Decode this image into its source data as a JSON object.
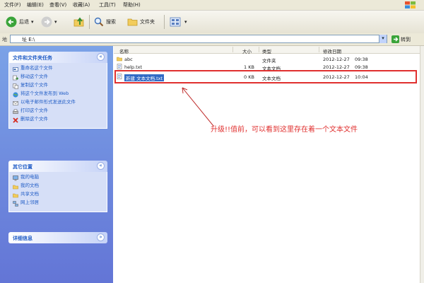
{
  "menubar": {
    "items": [
      "文件(F)",
      "编辑(E)",
      "查看(V)",
      "收藏(A)",
      "工具(T)",
      "帮助(H)"
    ]
  },
  "toolbar": {
    "back_label": "后退",
    "search_label": "搜索",
    "folders_label": "文件夹"
  },
  "address": {
    "label": "地",
    "value": "址 E:\\",
    "go_label": "转到"
  },
  "left_pane": {
    "tasks_panel": {
      "title": "文件和文件夹任务",
      "items": [
        "重命名这个文件",
        "移动这个文件",
        "复制这个文件",
        "将这个文件发布到 Web",
        "以电子邮件形式发送此文件",
        "打印这个文件",
        "删除这个文件"
      ]
    },
    "places_panel": {
      "title": "其它位置",
      "items": [
        "我的电脑",
        "我的文档",
        "共享文档",
        "网上邻居"
      ]
    },
    "details_panel": {
      "title": "详细信息"
    }
  },
  "file_list": {
    "columns": [
      "名称",
      "大小",
      "类型",
      "修改日期"
    ],
    "rows": [
      {
        "name": "abc",
        "size": "",
        "type": "文件夹",
        "date": "2012-12-27",
        "time": "09:38",
        "icon": "folder-icon"
      },
      {
        "name": "help.txt",
        "size": "1 KB",
        "type": "文本文档",
        "date": "2012-12-27",
        "time": "09:38",
        "icon": "text-file-icon"
      },
      {
        "name": "新建 文本文档.txt",
        "size": "0 KB",
        "type": "文本文档",
        "date": "2012-12-27",
        "time": "10:04",
        "icon": "text-file-icon"
      }
    ]
  },
  "annotation": {
    "text": "升级!!值前，可以看到这里存在着一个文本文件"
  },
  "colors": {
    "accent_red": "#e0302f",
    "pane_blue": "#6375d6",
    "selection_blue": "#316ac5"
  }
}
